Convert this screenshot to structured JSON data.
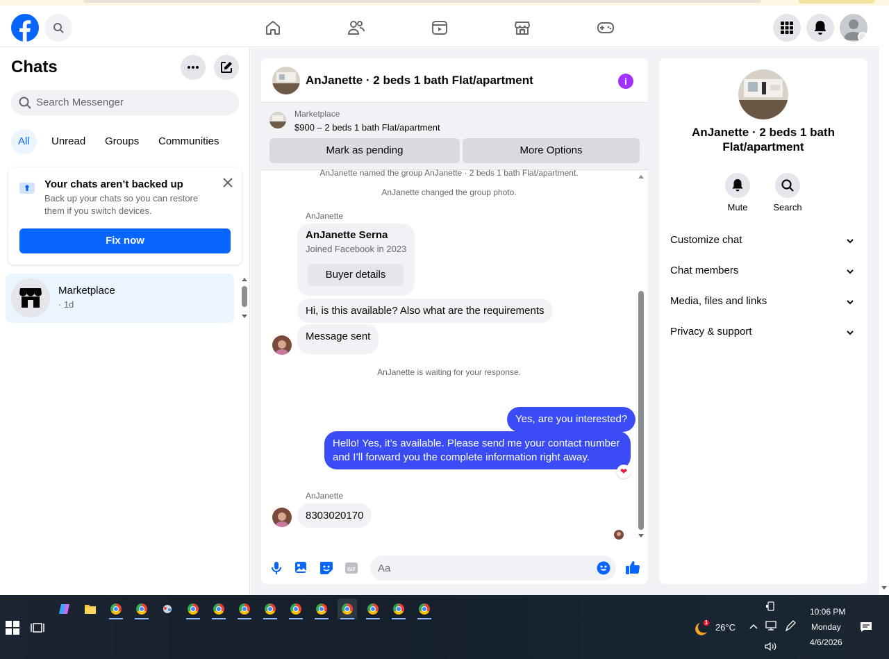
{
  "header": {
    "search_label": "Search Facebook",
    "nav": [
      "home-icon",
      "friends-icon",
      "video-icon",
      "marketplace-icon",
      "gaming-icon"
    ],
    "colors": {
      "brand": "#0866ff"
    }
  },
  "sidebar": {
    "title": "Chats",
    "search_placeholder": "Search Messenger",
    "filters": [
      "All",
      "Unread",
      "Groups",
      "Communities"
    ],
    "backup": {
      "title": "Your chats aren’t backed up",
      "body": "Back up your chats so you can restore them if you switch devices.",
      "button": "Fix now"
    },
    "conversations": [
      {
        "name": "Marketplace",
        "time": "· 1d"
      }
    ]
  },
  "chat": {
    "title": "AnJanette · 2 beds 1 bath Flat/apartment",
    "marketplace": {
      "label": "Marketplace",
      "listing": "$900 – 2 beds 1 bath Flat/apartment",
      "btn_pending": "Mark as pending",
      "btn_more": "More Options"
    },
    "system_1": "AnJanette named the group AnJanette · 2 beds 1 bath Flat/apartment.",
    "system_2": "AnJanette changed the group photo.",
    "sender": "AnJanette",
    "buyer": {
      "name": "AnJanette Serna",
      "joined": "Joined Facebook in 2023",
      "button": "Buyer details"
    },
    "in_1": "Hi, is this available? Also what are the requirements",
    "in_2": "Message sent",
    "system_3": "AnJanette is waiting for your response.",
    "out_1": "Yes, are you interested?",
    "out_2": "Hello! Yes, it’s available. Please send me your contact number and I’ll forward you the complete information right away.",
    "sender_2": "AnJanette",
    "in_3": "8303020170",
    "composer_placeholder": "Aa",
    "colors": {
      "outgoing": "#3a4cf5",
      "accent": "#0866ff"
    }
  },
  "info_panel": {
    "name": "AnJanette · 2 beds 1 bath Flat/apartment",
    "actions": [
      "Mute",
      "Search"
    ],
    "sections": [
      "Customize chat",
      "Chat members",
      "Media, files and links",
      "Privacy & support"
    ]
  },
  "taskbar": {
    "temperature": "26°C",
    "weather_badge": "1",
    "time": "10:06 PM",
    "day": "Monday",
    "date": "4/6/2026"
  }
}
